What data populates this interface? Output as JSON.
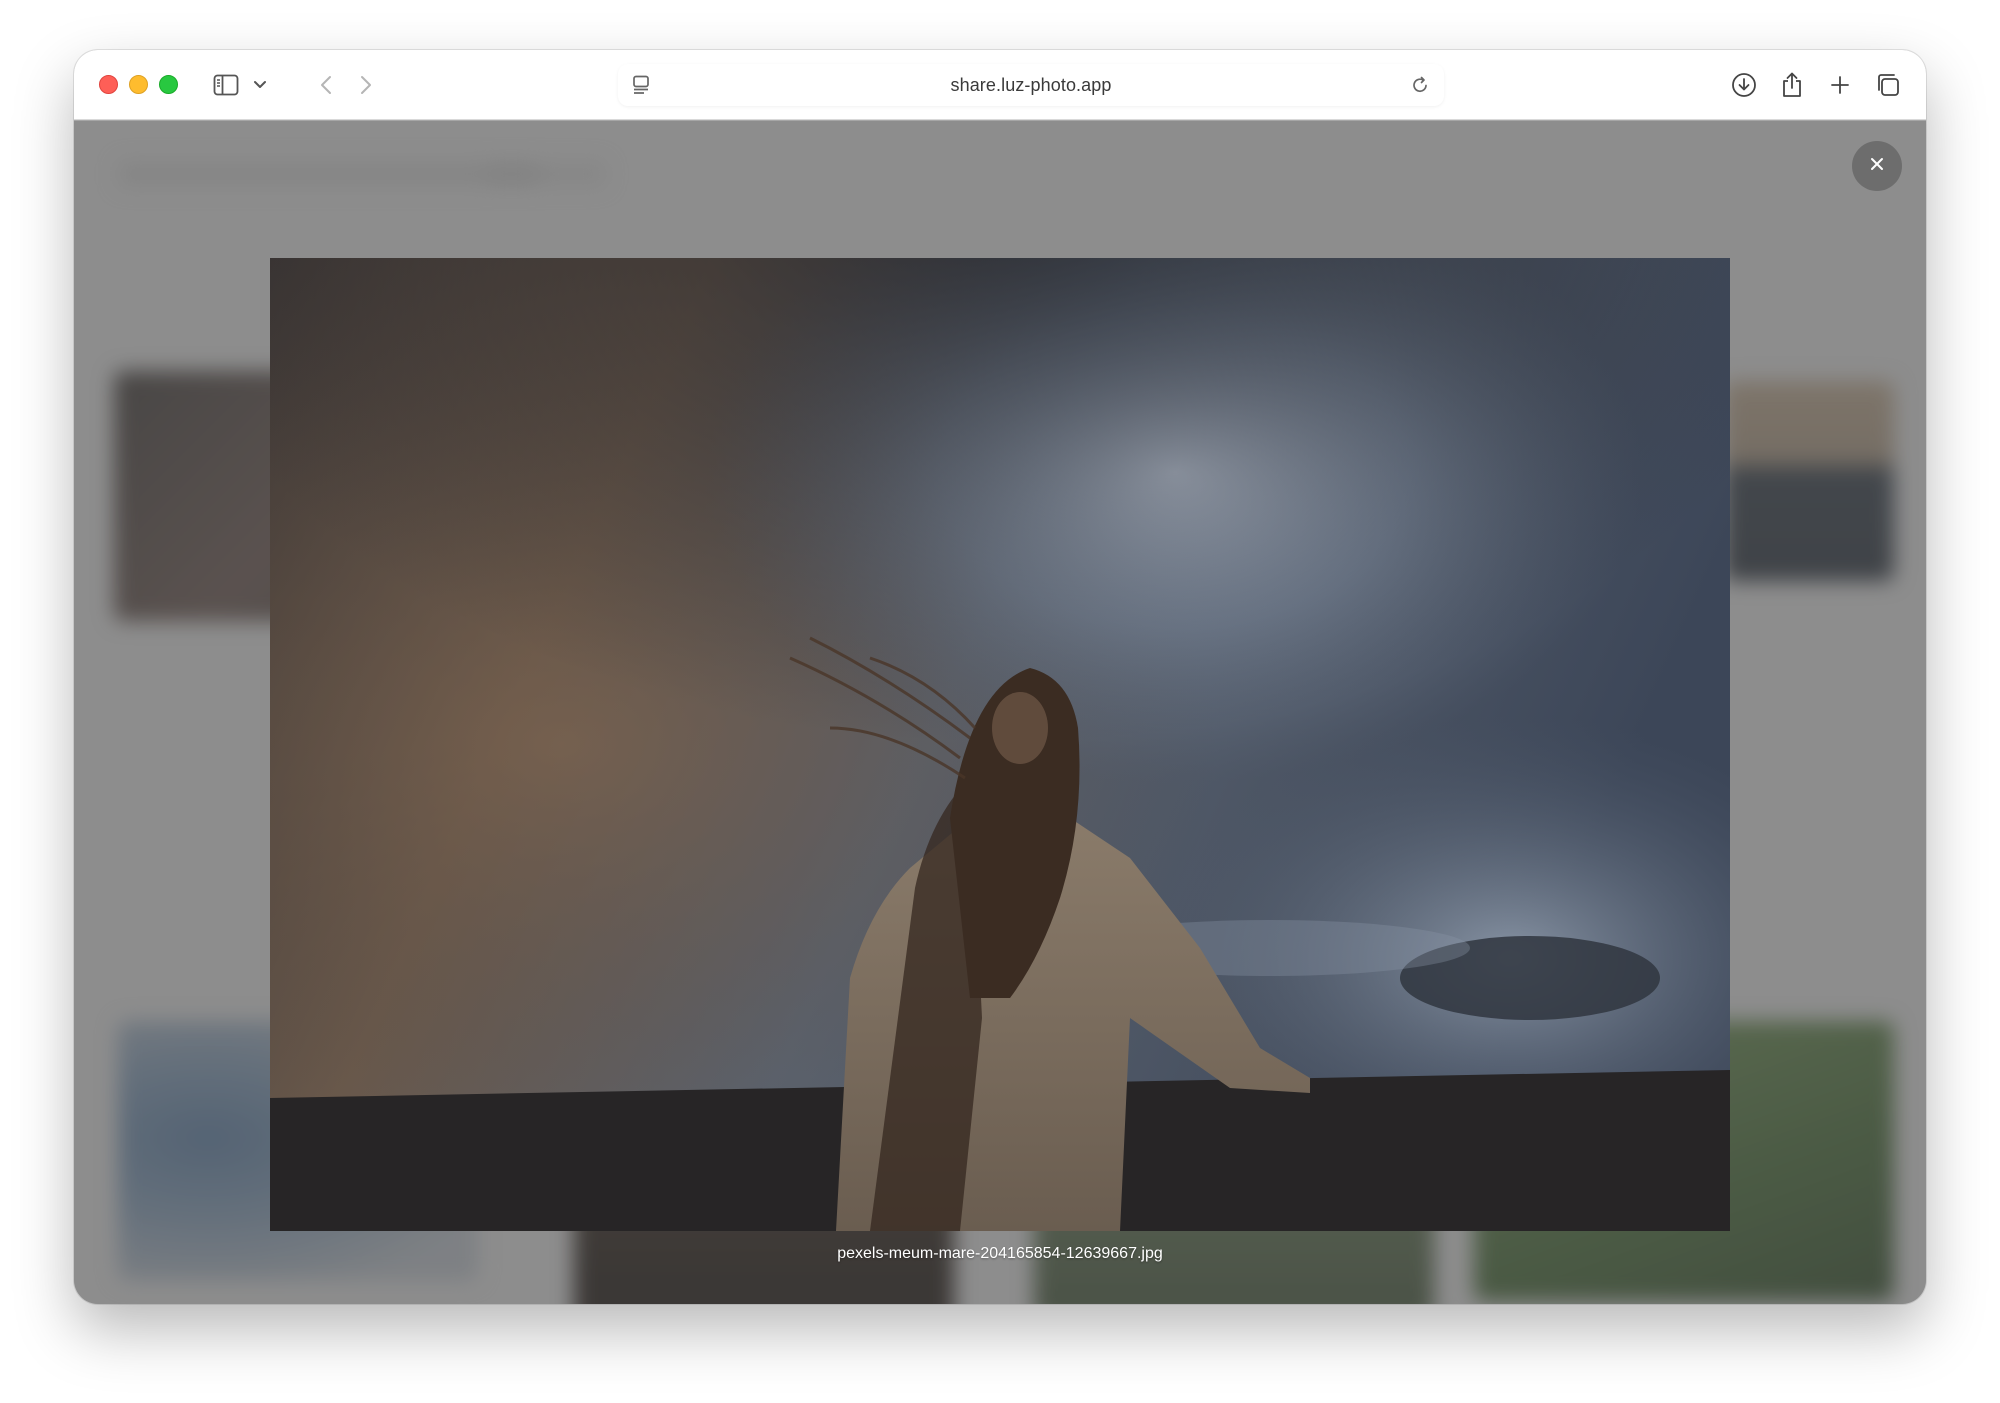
{
  "browser": {
    "url": "share.luz-photo.app"
  },
  "lightbox": {
    "caption": "pexels-meum-mare-204165854-12639667.jpg"
  },
  "icons": {
    "sidebar": "sidebar-icon",
    "sidebar_menu": "chevron-down-icon",
    "back": "chevron-left-icon",
    "forward": "chevron-right-icon",
    "reader": "reader-icon",
    "reload": "reload-icon",
    "download": "download-icon",
    "share": "share-icon",
    "new_tab": "plus-icon",
    "tabs": "tab-overview-icon",
    "close": "close-icon"
  },
  "colors": {
    "close_light": "#fe5f57",
    "minimize_light": "#febc2e",
    "zoom_light": "#28c840",
    "overlay": "#a6a6a6"
  }
}
